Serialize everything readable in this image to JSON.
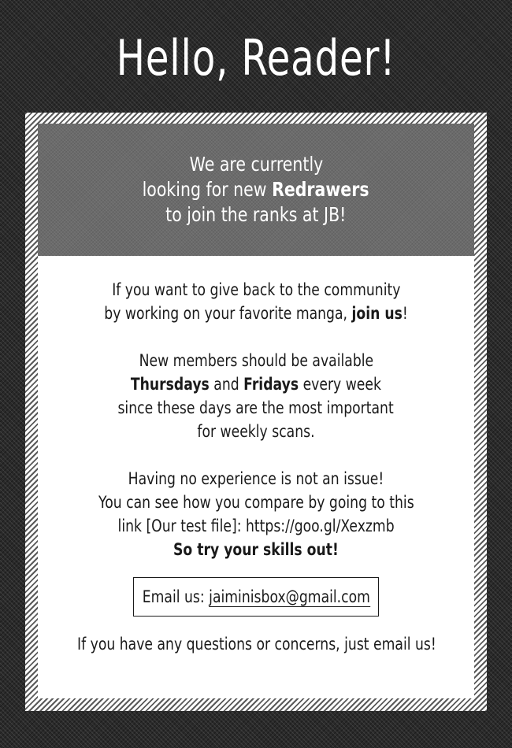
{
  "title": "Hello, Reader!",
  "banner": {
    "line1": "We are currently",
    "line2_prefix": "looking for new ",
    "line2_bold": "Redrawers",
    "line3": "to join the ranks at JB!"
  },
  "para1": {
    "line1": "If you want to give back to the community",
    "line2_prefix": "by working on your favorite manga, ",
    "line2_bold": "join us",
    "line2_suffix": "!"
  },
  "para2": {
    "line1": "New members should be available",
    "line2_bold1": "Thursdays",
    "line2_mid": " and ",
    "line2_bold2": "Fridays",
    "line2_suffix": " every week",
    "line3": "since these days are the most important",
    "line4": "for weekly scans."
  },
  "para3": {
    "line1": "Having no experience is not an issue!",
    "line2": "You can see how you compare by going to this",
    "line3": "link [Our test file]: https://goo.gl/Xexzmb",
    "line4_bold": "So try your skills out!"
  },
  "email": {
    "label": "Email us: ",
    "address": "jaiminisbox@gmail.com"
  },
  "footer": "If you have any questions or concerns, just email us!"
}
